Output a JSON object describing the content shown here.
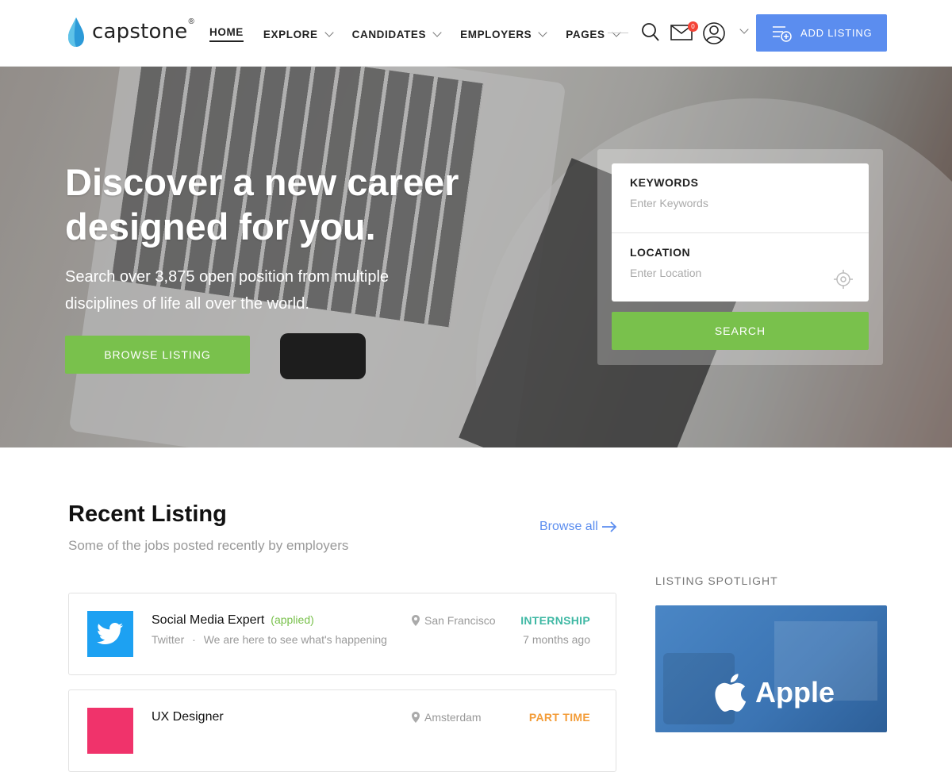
{
  "nav": {
    "logo_text": "capstone",
    "logo_reg": "®",
    "menu": [
      {
        "label": "HOME"
      },
      {
        "label": "EXPLORE"
      },
      {
        "label": "CANDIDATES"
      },
      {
        "label": "EMPLOYERS"
      },
      {
        "label": "PAGES"
      }
    ],
    "mail_badge": "0",
    "add_listing": "ADD LISTING"
  },
  "hero": {
    "title": "Discover a new career designed for you.",
    "subtitle": "Search over 3,875 open position from multiple disciplines of life all over the world.",
    "browse_button": "BROWSE LISTING",
    "search": {
      "keywords_label": "KEYWORDS",
      "keywords_placeholder": "Enter Keywords",
      "location_label": "LOCATION",
      "location_placeholder": "Enter Location",
      "search_button": "SEARCH"
    }
  },
  "recent": {
    "title": "Recent Listing",
    "subtitle": "Some of the jobs posted recently by employers",
    "browse_all": "Browse all",
    "jobs": [
      {
        "title": "Social Media Expert",
        "applied": "(applied)",
        "company": "Twitter",
        "separator": "·",
        "tagline": "We are here to see what's happening",
        "location": "San Francisco",
        "type": "INTERNSHIP",
        "type_color": "#3fb8a4",
        "time": "7 months ago",
        "logo": "twitter-logo",
        "logo_color": "#1da1f2"
      },
      {
        "title": "UX Designer",
        "applied": "",
        "company": "",
        "separator": "",
        "tagline": "",
        "location": "Amsterdam",
        "type": "PART TIME",
        "type_color": "#f39c38",
        "time": "",
        "logo": "pink-logo",
        "logo_color": "#f0336b"
      }
    ]
  },
  "spotlight": {
    "label": "LISTING SPOTLIGHT",
    "brand": "Apple"
  },
  "colors": {
    "accent_blue": "#5b8def",
    "accent_green": "#79c14c"
  }
}
